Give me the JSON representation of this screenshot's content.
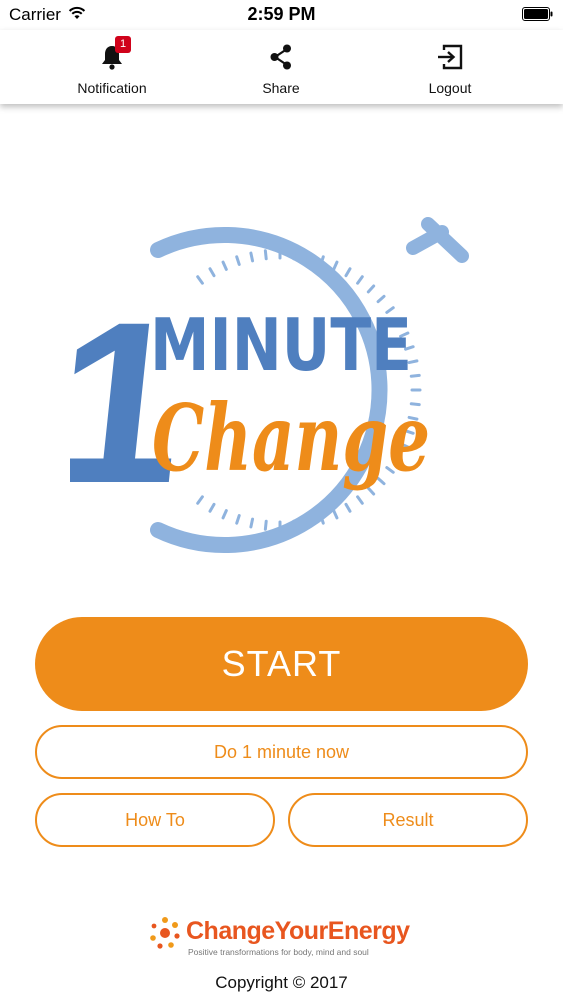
{
  "status_bar": {
    "carrier": "Carrier",
    "time": "2:59 PM"
  },
  "nav": {
    "notification": {
      "label": "Notification",
      "badge": "1",
      "icon": "bell-icon"
    },
    "share": {
      "label": "Share",
      "icon": "share-icon"
    },
    "logout": {
      "label": "Logout",
      "icon": "logout-icon"
    }
  },
  "logo": {
    "numeral": "1",
    "word1": "MINUTE",
    "word2": "Change",
    "colors": {
      "blue": "#4f7fbf",
      "light_blue": "#8fb3de",
      "orange": "#ee8c1a"
    }
  },
  "buttons": {
    "start": "START",
    "do_now": "Do 1 minute now",
    "how_to": "How To",
    "result": "Result"
  },
  "footer": {
    "brand_name": "ChangeYourEnergy",
    "brand_tagline": "Positive transformations for body, mind and soul",
    "copyright": "Copyright © 2017"
  },
  "colors": {
    "accent": "#ee8c1a",
    "badge": "#d0021b",
    "brand": "#e8561f"
  }
}
